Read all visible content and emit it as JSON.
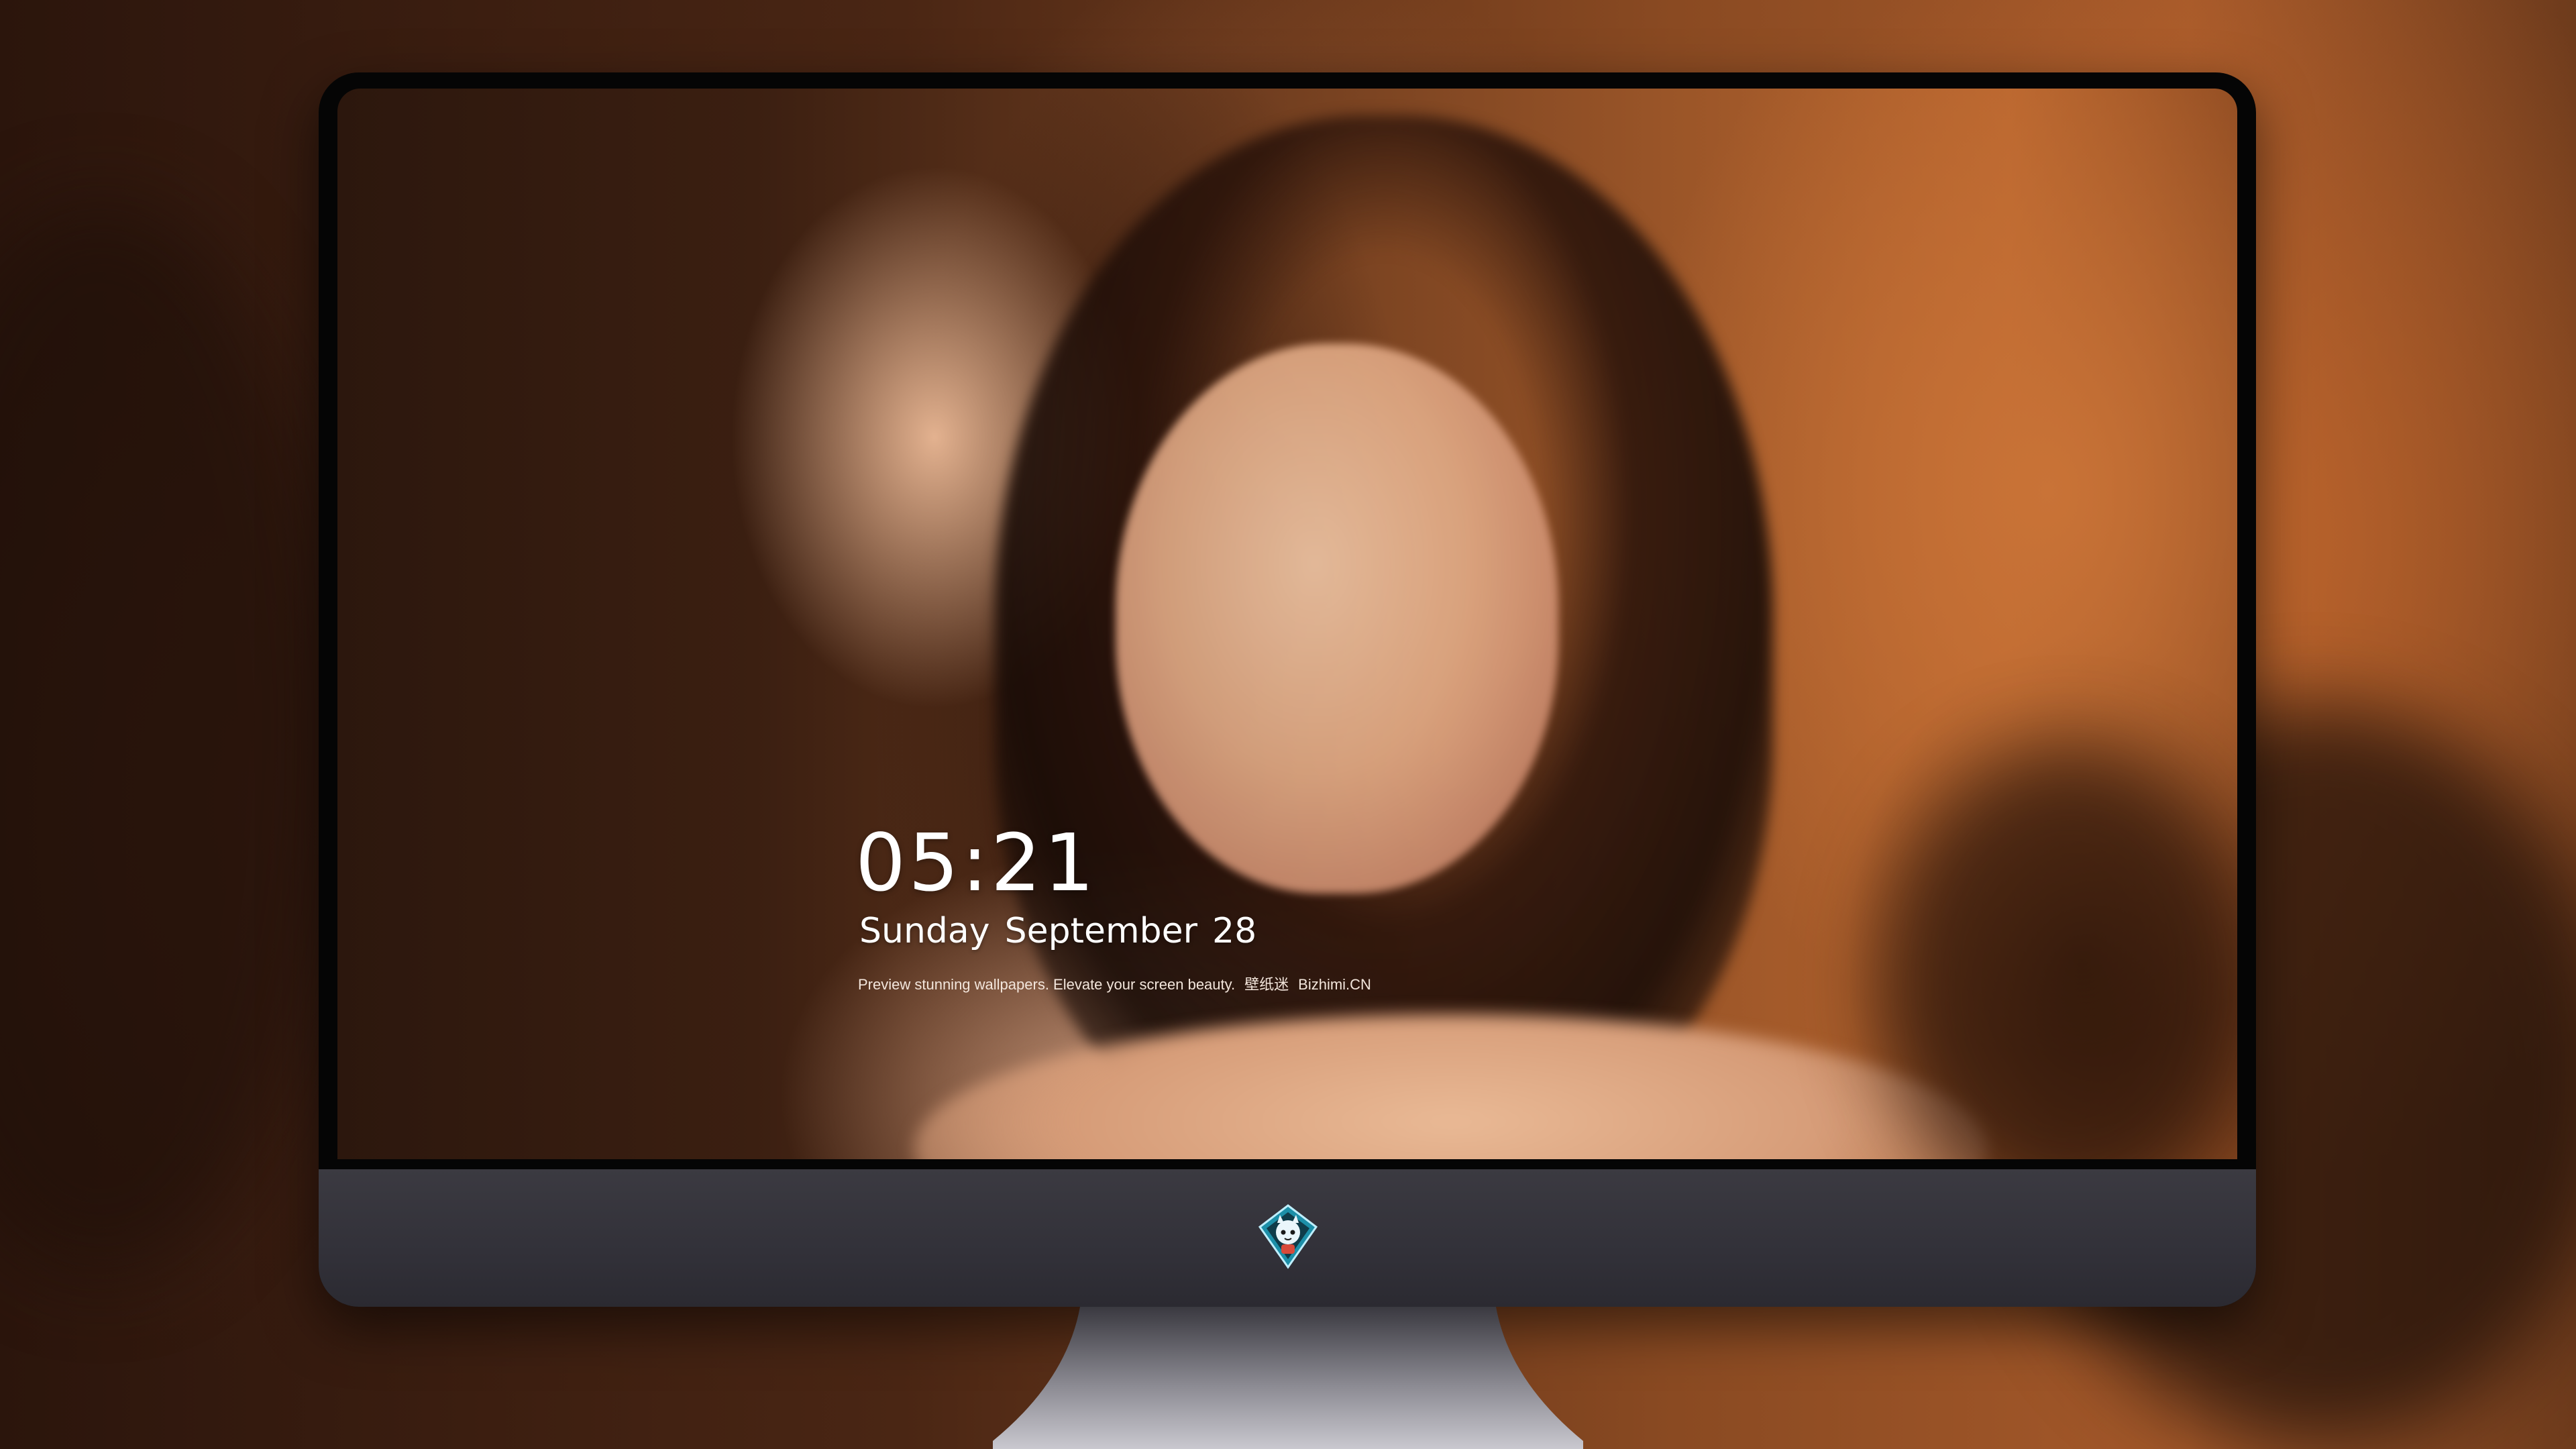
{
  "lockscreen": {
    "time": "05:21",
    "date": {
      "weekday": "Sunday",
      "month": "September",
      "day": "28"
    },
    "caption": {
      "text": "Preview stunning wallpapers. Elevate your screen beauty.",
      "brand_cn": "壁纸迷",
      "brand_site": "Bizhimi.CN"
    }
  },
  "dock": {
    "apps": [
      {
        "name": "messages-icon",
        "color": "#34c759"
      },
      {
        "name": "weather-icon",
        "color": "#2f8cf0"
      },
      {
        "name": "clock-icon",
        "color": "#111111"
      },
      {
        "name": "preview-icon",
        "color": "#e9f1f8"
      },
      {
        "name": "claquette-icon",
        "color": "#4bb7e8"
      },
      {
        "name": "notes-icon",
        "color": "#f7d145"
      },
      {
        "name": "photo-booth-icon",
        "color": "#dfe6ee"
      },
      {
        "name": "music-icon",
        "color": "#f24be0"
      },
      {
        "name": "app-store-icon",
        "color": "#1e8ef7"
      },
      {
        "name": "camera-icon",
        "color": "#6d6d72"
      }
    ]
  },
  "colors": {
    "bezel": "#050505",
    "chin": "#34333a",
    "wallpaper_accent": "#b8652e",
    "text": "#ffffff"
  }
}
